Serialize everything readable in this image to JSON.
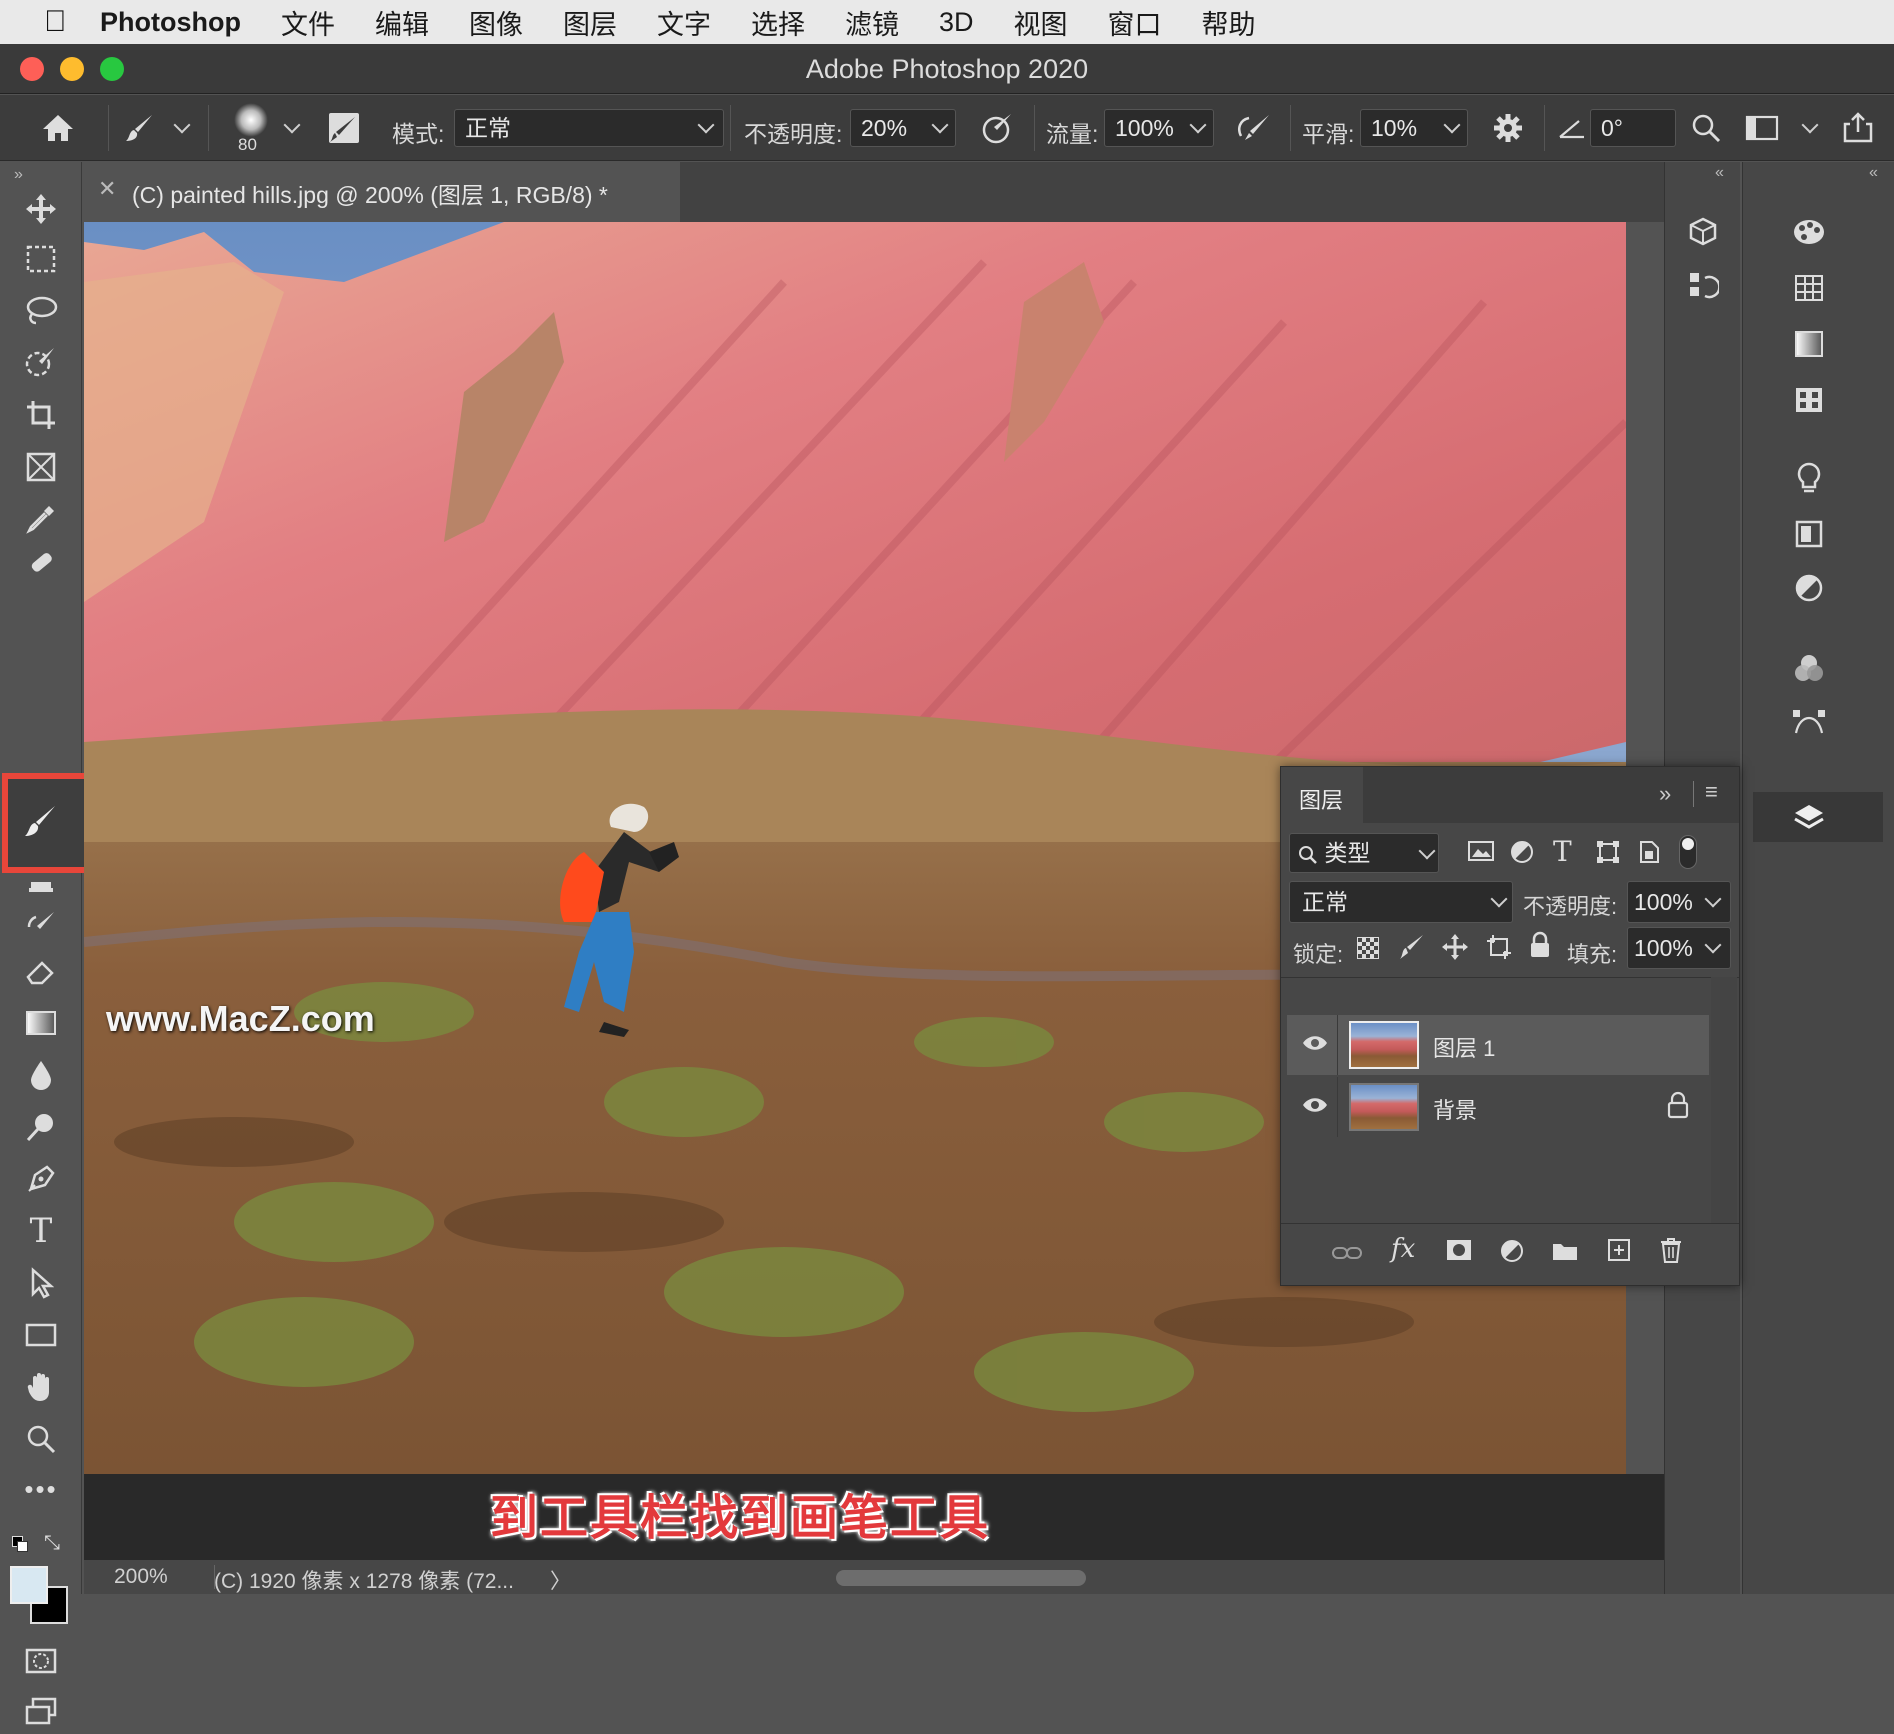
{
  "menubar": {
    "app": "Photoshop",
    "items": [
      "文件",
      "编辑",
      "图像",
      "图层",
      "文字",
      "选择",
      "滤镜",
      "3D",
      "视图",
      "窗口",
      "帮助"
    ]
  },
  "window": {
    "title": "Adobe Photoshop 2020"
  },
  "options": {
    "brush_size": "80",
    "mode_label": "模式:",
    "mode_value": "正常",
    "opacity_label": "不透明度:",
    "opacity_value": "20%",
    "flow_label": "流量:",
    "flow_value": "100%",
    "smooth_label": "平滑:",
    "smooth_value": "10%",
    "angle_value": "0°"
  },
  "document": {
    "tab_title": "(C) painted hills.jpg @ 200% (图层 1, RGB/8) *",
    "watermark": "www.MacZ.com",
    "caption": "到工具栏找到画笔工具"
  },
  "status": {
    "zoom": "200%",
    "info": "(C) 1920 像素 x 1278 像素 (72...",
    "arrow": "〉"
  },
  "layers_panel": {
    "tab": "图层",
    "filter_label": "类型",
    "blend_mode": "正常",
    "opacity_label": "不透明度:",
    "opacity_value": "100%",
    "lock_label": "锁定:",
    "fill_label": "填充:",
    "fill_value": "100%",
    "layers": [
      {
        "name": "图层 1",
        "selected": true,
        "locked": false
      },
      {
        "name": "背景",
        "selected": false,
        "locked": true
      }
    ]
  },
  "icons": {
    "tools": [
      "move-icon",
      "marquee-icon",
      "lasso-icon",
      "quick-select-icon",
      "crop-icon",
      "frame-icon",
      "eyedropper-icon",
      "healing-icon",
      "brush-icon",
      "stamp-icon",
      "history-brush-icon",
      "eraser-icon",
      "gradient-icon",
      "blur-icon",
      "dodge-icon",
      "pen-icon",
      "type-icon",
      "path-select-icon",
      "rectangle-icon",
      "hand-icon",
      "zoom-icon",
      "more-icon"
    ],
    "accent_highlight": "#e8463a"
  }
}
